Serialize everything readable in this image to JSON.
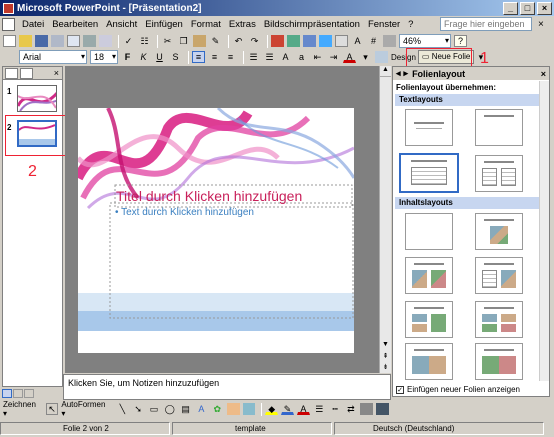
{
  "window": {
    "title": "Microsoft PowerPoint - [Präsentation2]"
  },
  "menu": {
    "items": [
      "Datei",
      "Bearbeiten",
      "Ansicht",
      "Einfügen",
      "Format",
      "Extras",
      "Bildschirmpräsentation",
      "Fenster",
      "?"
    ],
    "help_placeholder": "Frage hier eingeben"
  },
  "toolbar": {
    "zoom": "46%",
    "font": "Arial",
    "size": "18",
    "design_label": "Design",
    "new_slide_label": "Neue Folie"
  },
  "callouts": {
    "one": "1",
    "two": "2"
  },
  "slides": {
    "thumb1_num": "1",
    "thumb2_num": "2"
  },
  "slide": {
    "title_placeholder": "Titel durch Klicken hinzufügen",
    "text_placeholder": "• Text durch Klicken hinzufügen"
  },
  "notes": {
    "placeholder": "Klicken Sie, um Notizen hinzuzufügen"
  },
  "taskpane": {
    "title": "Folienlayout",
    "apply_label": "Folienlayout übernehmen:",
    "group_text": "Textlayouts",
    "group_content": "Inhaltslayouts",
    "checkbox_label": "Einfügen neuer Folien anzeigen"
  },
  "drawing": {
    "draw_label": "Zeichnen ▾",
    "autoshapes_label": "AutoFormen ▾"
  },
  "status": {
    "slide": "Folie 2 von 2",
    "template": "template",
    "language": "Deutsch (Deutschland)"
  },
  "colors": {
    "title_red": "#c8205a",
    "body_blue": "#3a7fc0",
    "callout": "#e22233"
  }
}
